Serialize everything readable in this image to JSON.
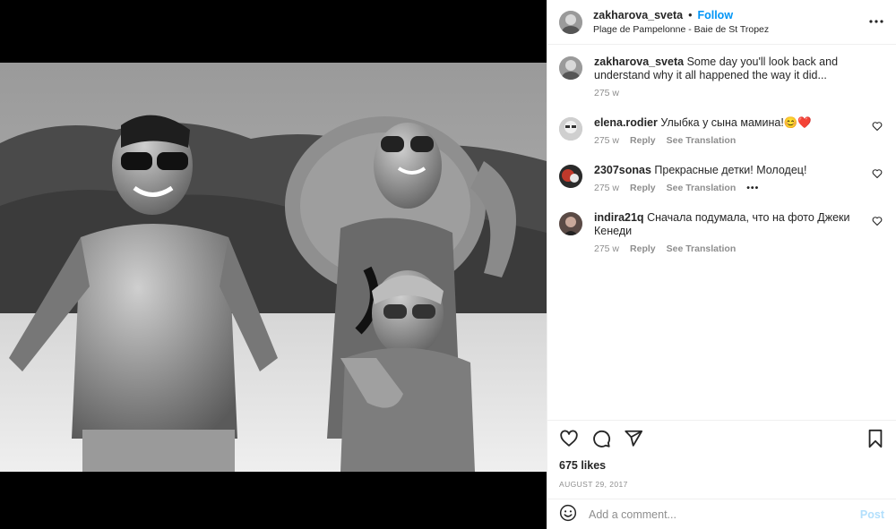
{
  "post": {
    "username": "zakharova_sveta",
    "dot": "•",
    "follow_label": "Follow",
    "location": "Plage de Pampelonne - Baie de St Tropez",
    "photo_icon": "beach-family-photo"
  },
  "caption": {
    "username": "zakharova_sveta",
    "text": "Some day you'll look back and understand why it all happened the way it did...",
    "time": "275 w"
  },
  "comments": [
    {
      "username": "elena.rodier",
      "text": "Улыбка у сына мамина!😊❤️",
      "time": "275 w",
      "reply": "Reply",
      "translate": "See Translation"
    },
    {
      "username": "2307sonas",
      "text": "Прекрасные детки! Молодец!",
      "time": "275 w",
      "reply": "Reply",
      "translate": "See Translation",
      "more": "•••"
    },
    {
      "username": "indira21q",
      "text": "Сначала подумала, что на фото Джеки Кенеди",
      "time": "275 w",
      "reply": "Reply",
      "translate": "See Translation"
    }
  ],
  "footer": {
    "likes": "675 likes",
    "date": "AUGUST 29, 2017",
    "comment_placeholder": "Add a comment...",
    "post_label": "Post"
  },
  "colors": {
    "accent": "#0095f6",
    "post_disabled": "#b2dffc",
    "muted": "#8e8e8e"
  },
  "icons": [
    "more-options-icon",
    "heart-icon",
    "comment-icon",
    "share-icon",
    "bookmark-icon",
    "emoji-icon"
  ]
}
